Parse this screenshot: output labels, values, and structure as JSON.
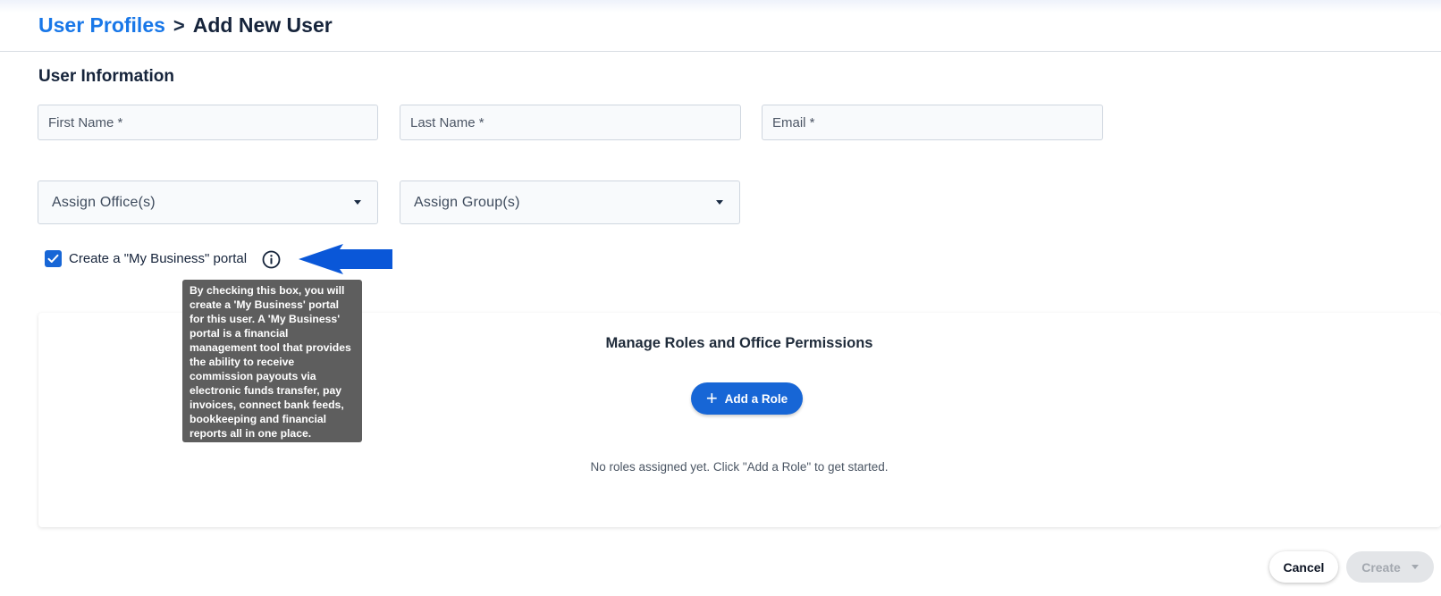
{
  "breadcrumb": {
    "parent": "User Profiles",
    "separator": ">",
    "current": "Add New User"
  },
  "user_information": {
    "title": "User Information",
    "first_name": {
      "placeholder": "First Name *",
      "value": ""
    },
    "last_name": {
      "placeholder": "Last Name *",
      "value": ""
    },
    "email": {
      "placeholder": "Email *",
      "value": ""
    },
    "assign_offices": {
      "label": "Assign Office(s)"
    },
    "assign_groups": {
      "label": "Assign Group(s)"
    }
  },
  "portal_checkbox": {
    "label": "Create a \"My Business\" portal",
    "checked": true,
    "tooltip": "By checking this box, you will create a 'My Business' portal for this user. A 'My Business' portal is a financial management tool that provides the ability to receive commission payouts via electronic funds transfer, pay invoices, connect bank feeds, bookkeeping and financial reports all in one place."
  },
  "roles": {
    "title": "Manage Roles and Office Permissions",
    "add_label": "Add a Role",
    "empty_message": "No roles assigned yet. Click \"Add a Role\" to get started."
  },
  "footer": {
    "cancel_label": "Cancel",
    "create_label": "Create"
  },
  "colors": {
    "primary": "#1766d6",
    "link": "#1877e8",
    "arrow": "#0a57d8",
    "tooltip_bg": "#5e5e5e"
  },
  "icons": {
    "info": "info-circle-icon",
    "check": "checkmark-icon",
    "plus": "plus-icon",
    "dropdown": "chevron-down-icon",
    "annotation": "arrow-left-icon"
  }
}
